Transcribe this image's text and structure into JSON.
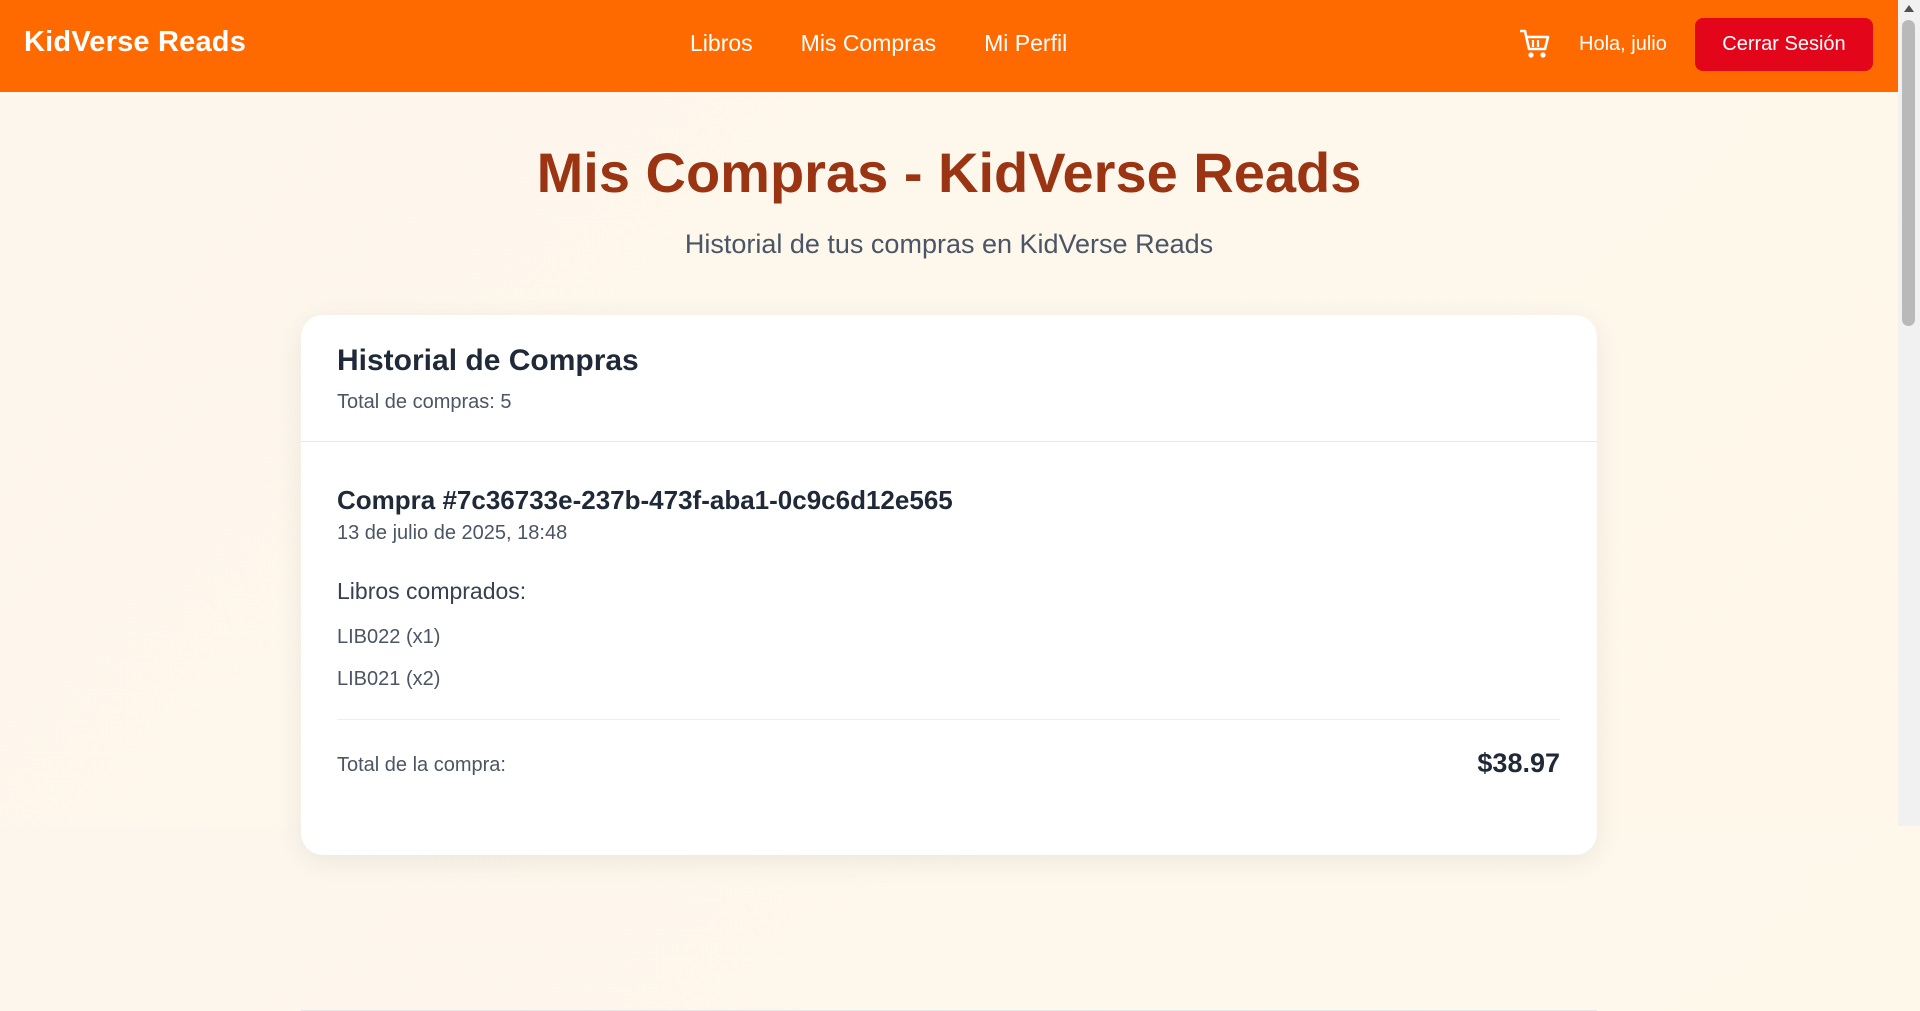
{
  "nav": {
    "brand": "KidVerse Reads",
    "links": [
      "Libros",
      "Mis Compras",
      "Mi Perfil"
    ],
    "greeting": "Hola, julio",
    "logout_label": "Cerrar Sesión",
    "cart_icon": "cart-icon"
  },
  "page": {
    "title": "Mis Compras - KidVerse Reads",
    "subtitle": "Historial de tus compras en KidVerse Reads"
  },
  "history": {
    "title": "Historial de Compras",
    "count_text": "Total de compras: 5",
    "orders": [
      {
        "id": "Compra #7c36733e-237b-473f-aba1-0c9c6d12e565",
        "date": "13 de julio de 2025, 18:48",
        "books_label": "Libros comprados:",
        "books": [
          "LIB022 (x1)",
          "LIB021 (x2)"
        ],
        "total_label": "Total de la compra:",
        "total": "$38.97"
      }
    ]
  },
  "colors": {
    "navbar": "#ff6a00",
    "logout_button": "#e3061b",
    "title": "#9a3412"
  }
}
